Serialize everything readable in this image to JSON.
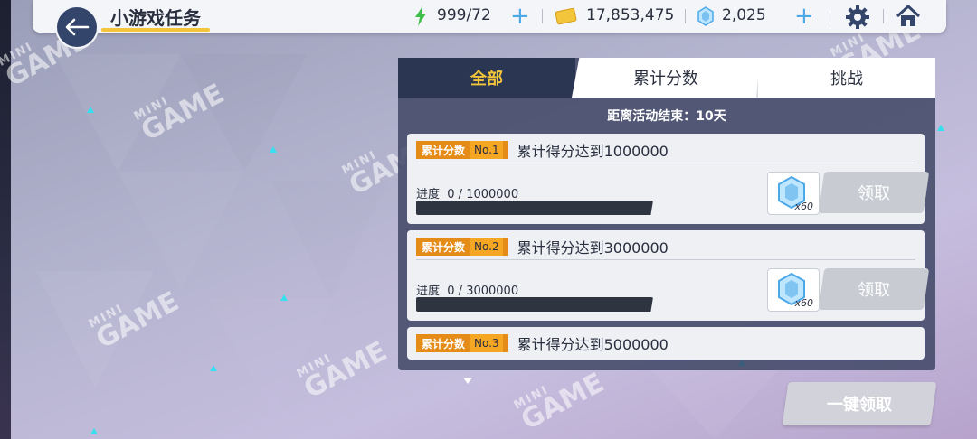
{
  "header": {
    "title": "小游戏任务",
    "stamina": "999/72",
    "coins": "17,853,475",
    "gems": "2,025"
  },
  "tabs": [
    {
      "label": "全部",
      "active": true
    },
    {
      "label": "累计分数",
      "active": false
    },
    {
      "label": "挑战",
      "active": false
    }
  ],
  "countdown": "距离活动结束：10天",
  "tasks": [
    {
      "tag": "累计分数",
      "no": "No.1",
      "title": "累计得分达到1000000",
      "progress_label": "进度",
      "progress": "0 / 1000000",
      "progress_value": 0,
      "reward_qty": "x60",
      "claim_label": "领取"
    },
    {
      "tag": "累计分数",
      "no": "No.2",
      "title": "累计得分达到3000000",
      "progress_label": "进度",
      "progress": "0 / 3000000",
      "progress_value": 0,
      "reward_qty": "x60",
      "claim_label": "领取"
    },
    {
      "tag": "累计分数",
      "no": "No.3",
      "title": "累计得分达到5000000"
    }
  ],
  "claim_all_label": "一键领取",
  "watermark": {
    "small": "MINI",
    "big": "GAME"
  },
  "colors": {
    "accent": "#f3c53a",
    "tag": "#e58b17",
    "panel": "#2b3752",
    "gem": "#4da8e8",
    "stamina": "#3fbf4a"
  }
}
